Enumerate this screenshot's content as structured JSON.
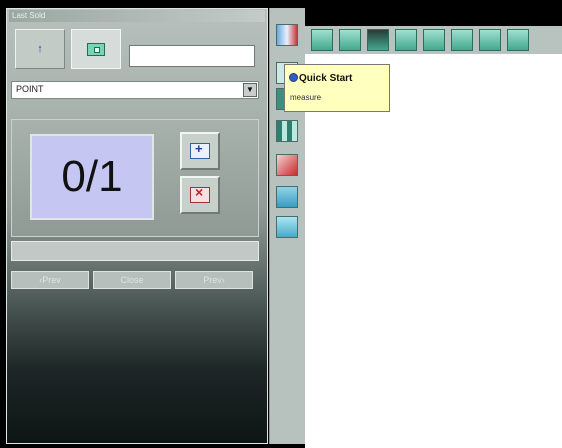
{
  "panel": {
    "title": "Last Sold",
    "text_input_value": "",
    "combo_value": "POINT",
    "counter_text": "0/1",
    "nav_buttons": [
      "‹Prev",
      "Close",
      "Prev›"
    ]
  },
  "toolbar": {
    "vertical_icons": [
      "measure-tool-icon",
      "quick-start-icon",
      "next-icon",
      "grid-icon",
      "red-flag-icon",
      "zoom-icon",
      "document-icon"
    ],
    "horizontal_icons": [
      "image-icon",
      "line-icon",
      "point-icon",
      "square-icon",
      "columns-icon",
      "pane-icon",
      "globe-icon",
      "help-icon"
    ]
  },
  "tooltip": {
    "title": "Quick Start",
    "subtitle": "measure"
  },
  "colors": {
    "tooltip_bg": "#ffffbe",
    "counter_bg": "#c5c6f2",
    "accent_green": "#43a88f"
  }
}
